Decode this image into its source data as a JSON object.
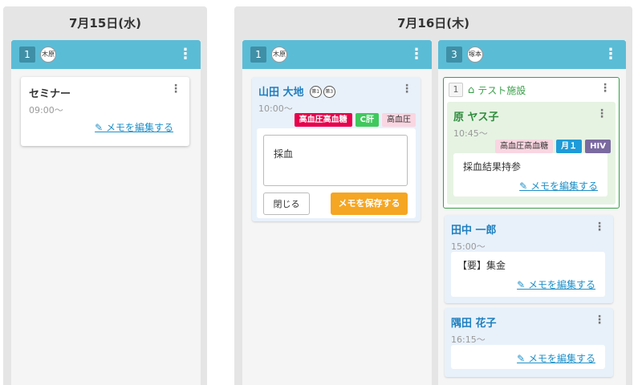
{
  "days": [
    {
      "title": "7月15日(水)"
    },
    {
      "title": "7月16日(木)"
    }
  ],
  "columns": [
    {
      "number": "1",
      "staff": "木原"
    },
    {
      "number": "1",
      "staff": "木原"
    },
    {
      "number": "3",
      "staff": "塚本"
    }
  ],
  "seminar": {
    "name": "セミナー",
    "time": "09:00〜",
    "memo_link": "メモを編集する"
  },
  "yamada": {
    "name": "山田 大地",
    "badges": [
      "第1",
      "第3"
    ],
    "time": "10:00〜",
    "tags": [
      "高血圧高血糖",
      "C肝",
      "高血圧"
    ],
    "memo_value": "採血",
    "close_label": "閉じる",
    "save_label": "メモを保存する"
  },
  "facility": {
    "number": "1",
    "name": "テスト施設",
    "patient": {
      "name": "原 ヤス子",
      "time": "10:45〜",
      "tags": [
        "高血圧高血糖",
        "月１",
        "HIV"
      ],
      "memo": "採血結果持参",
      "memo_link": "メモを編集する"
    }
  },
  "tanaka": {
    "name": "田中 一郎",
    "time": "15:00〜",
    "memo": "【要】集金",
    "memo_link": "メモを編集する"
  },
  "sumida": {
    "name": "隅田 花子",
    "time": "16:15〜",
    "memo_link": "メモを編集する"
  },
  "colors": {
    "header": "#5bbcd6",
    "accent_orange": "#f5a623",
    "link": "#1e7fbf",
    "facility_green": "#3aa04a"
  }
}
